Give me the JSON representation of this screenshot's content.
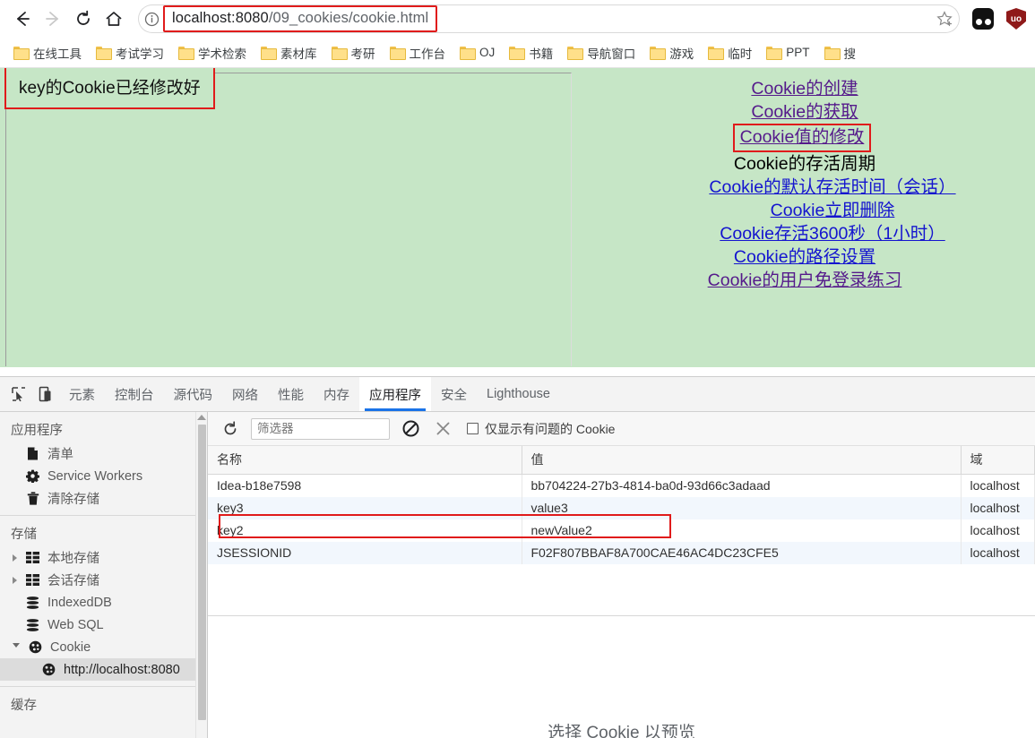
{
  "browser": {
    "nav": {
      "back": "back-arrow",
      "forward": "forward-arrow",
      "reload": "reload",
      "home": "home"
    },
    "omnibox": {
      "info_icon": "info-circle-icon",
      "url_host": "localhost:8080",
      "url_path": "/09_cookies/cookie.html",
      "star_icon": "bookmark-star-icon"
    },
    "extensions": [
      {
        "name": "dark-extension-icon",
        "label": ""
      },
      {
        "name": "ublock-origin-icon",
        "label": "uo"
      }
    ],
    "bookmarks": [
      {
        "label": "在线工具"
      },
      {
        "label": "考试学习"
      },
      {
        "label": "学术检索"
      },
      {
        "label": "素材库"
      },
      {
        "label": "考研"
      },
      {
        "label": "工作台"
      },
      {
        "label": "OJ"
      },
      {
        "label": "书籍"
      },
      {
        "label": "导航窗口"
      },
      {
        "label": "游戏"
      },
      {
        "label": "临时"
      },
      {
        "label": "PPT"
      },
      {
        "label": "搜"
      }
    ]
  },
  "page": {
    "alert_text": "key的Cookie已经修改好",
    "background_color": "#c6e6c6",
    "links": [
      {
        "label": "Cookie的创建",
        "style": "visited",
        "indent": false,
        "highlighted": false
      },
      {
        "label": "Cookie的获取",
        "style": "visited",
        "indent": false,
        "highlighted": false
      },
      {
        "label": "Cookie值的修改",
        "style": "visited",
        "indent": false,
        "highlighted": true
      },
      {
        "label": "Cookie的存活周期",
        "style": "plain",
        "indent": false,
        "highlighted": false
      },
      {
        "label": "Cookie的默认存活时间（会话）",
        "style": "blue",
        "indent": true,
        "highlighted": false
      },
      {
        "label": "Cookie立即删除",
        "style": "blue",
        "indent": true,
        "highlighted": false
      },
      {
        "label": "Cookie存活3600秒（1小时）",
        "style": "blue",
        "indent": true,
        "highlighted": false
      },
      {
        "label": "Cookie的路径设置",
        "style": "blue",
        "indent": false,
        "highlighted": false
      },
      {
        "label": "Cookie的用户免登录练习",
        "style": "visited",
        "indent": false,
        "highlighted": false
      }
    ]
  },
  "devtools": {
    "inspect_icon": "inspect-element-icon",
    "device_icon": "device-toolbar-icon",
    "tabs": [
      {
        "label": "元素",
        "active": false
      },
      {
        "label": "控制台",
        "active": false
      },
      {
        "label": "源代码",
        "active": false
      },
      {
        "label": "网络",
        "active": false
      },
      {
        "label": "性能",
        "active": false
      },
      {
        "label": "内存",
        "active": false
      },
      {
        "label": "应用程序",
        "active": true
      },
      {
        "label": "安全",
        "active": false
      },
      {
        "label": "Lighthouse",
        "active": false
      }
    ],
    "sidebar": {
      "sections": [
        {
          "title": "应用程序",
          "items": [
            {
              "label": "清单",
              "icon": "manifest-file-icon",
              "arrow": "none",
              "selected": false,
              "sub": false
            },
            {
              "label": "Service Workers",
              "icon": "gear-icon",
              "arrow": "none",
              "selected": false,
              "sub": false
            },
            {
              "label": "清除存储",
              "icon": "trash-icon",
              "arrow": "none",
              "selected": false,
              "sub": false
            }
          ]
        },
        {
          "title": "存储",
          "items": [
            {
              "label": "本地存储",
              "icon": "table-grid-icon",
              "arrow": "closed",
              "selected": false,
              "sub": false
            },
            {
              "label": "会话存储",
              "icon": "table-grid-icon",
              "arrow": "closed",
              "selected": false,
              "sub": false
            },
            {
              "label": "IndexedDB",
              "icon": "database-icon",
              "arrow": "none",
              "selected": false,
              "sub": false
            },
            {
              "label": "Web SQL",
              "icon": "database-icon",
              "arrow": "none",
              "selected": false,
              "sub": false
            },
            {
              "label": "Cookie",
              "icon": "cookie-icon",
              "arrow": "open",
              "selected": false,
              "sub": false
            },
            {
              "label": "http://localhost:8080",
              "icon": "cookie-icon",
              "arrow": "none",
              "selected": true,
              "sub": true
            }
          ]
        },
        {
          "title": "缓存",
          "items": []
        }
      ]
    },
    "cookie_toolbar": {
      "refresh_icon": "refresh-icon",
      "filter_placeholder": "筛选器",
      "filter_value": "",
      "clear_icon": "clear-all-cookies-icon",
      "delete_icon": "delete-selected-icon",
      "checkbox_label": "仅显示有问题的 Cookie",
      "checkbox_checked": false
    },
    "cookie_table": {
      "columns": [
        "名称",
        "值",
        "域"
      ],
      "rows": [
        {
          "name": "Idea-b18e7598",
          "value": "bb704224-27b3-4814-ba0d-93d66c3adaad",
          "domain": "localhost",
          "highlighted": false
        },
        {
          "name": "key3",
          "value": "value3",
          "domain": "localhost",
          "highlighted": false
        },
        {
          "name": "key2",
          "value": "newValue2",
          "domain": "localhost",
          "highlighted": true
        },
        {
          "name": "JSESSIONID",
          "value": "F02F807BBAF8A700CAE46AC4DC23CFE5",
          "domain": "localhost",
          "highlighted": false
        }
      ]
    },
    "preview_placeholder": "选择 Cookie 以预览"
  },
  "colors": {
    "accent": "#1a73e8",
    "highlight_red": "#e01b1b",
    "page_green": "#c6e6c6",
    "link_visited": "#551a8b",
    "link_blue": "#1414cf"
  }
}
